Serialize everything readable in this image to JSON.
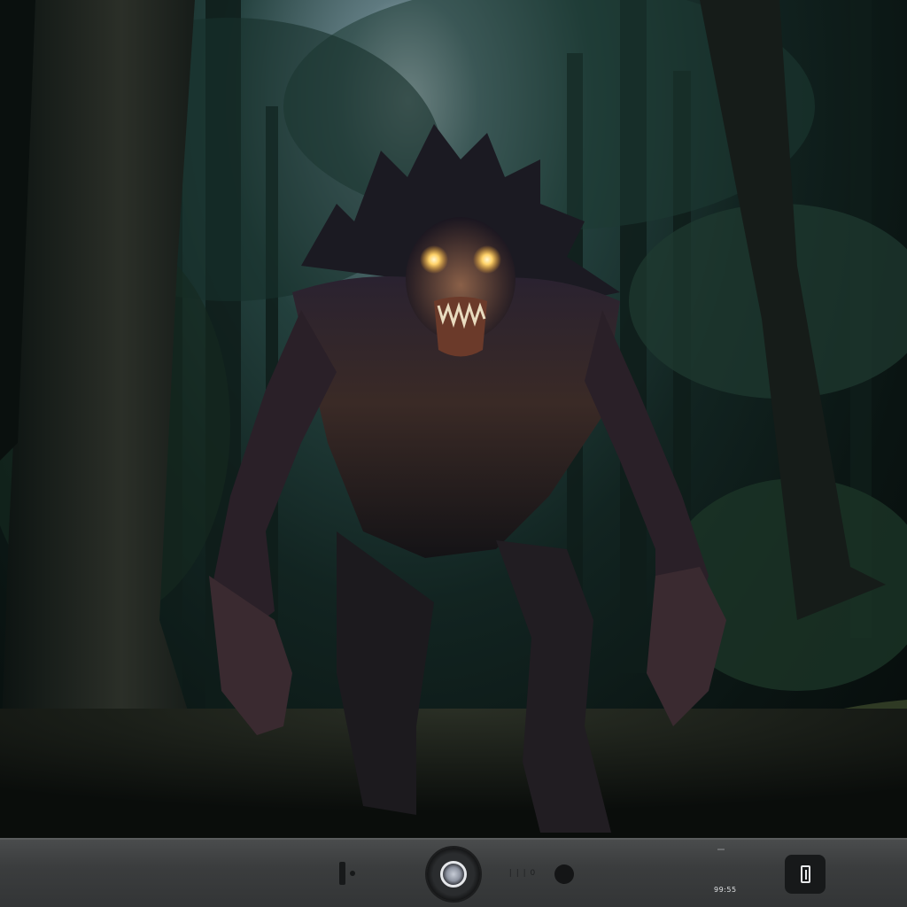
{
  "viewfinder": {
    "subject": "creature-in-forest",
    "palette": {
      "sky": "#c9d6de",
      "foliage": "#1f3a34",
      "eyes": "#ffd36a",
      "skin": "#5a3a2e"
    }
  },
  "controls": {
    "shutter_icon": "shutter-icon",
    "flash_icon": "flash-toggle-icon",
    "record_icon": "record-dot-icon",
    "gallery_icon": "gallery-icon",
    "mode_label": "| | | 0",
    "counter": "99:55"
  }
}
